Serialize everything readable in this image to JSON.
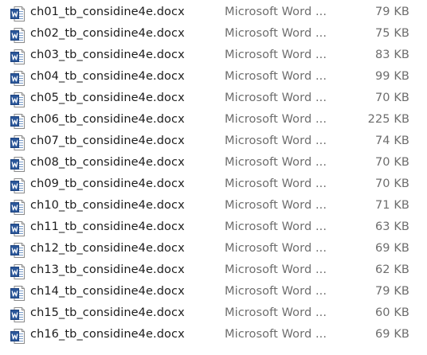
{
  "file_list": {
    "icon": "word-document-icon",
    "colors": {
      "word_blue": "#2b579a",
      "name_text": "#1c1c1c",
      "secondary_text": "#6d6d6d"
    },
    "rows": [
      {
        "name": "ch01_tb_considine4e.docx",
        "type": "Microsoft Word ...",
        "size": "79 KB"
      },
      {
        "name": "ch02_tb_considine4e.docx",
        "type": "Microsoft Word ...",
        "size": "75 KB"
      },
      {
        "name": "ch03_tb_considine4e.docx",
        "type": "Microsoft Word ...",
        "size": "83 KB"
      },
      {
        "name": "ch04_tb_considine4e.docx",
        "type": "Microsoft Word ...",
        "size": "99 KB"
      },
      {
        "name": "ch05_tb_considine4e.docx",
        "type": "Microsoft Word ...",
        "size": "70 KB"
      },
      {
        "name": "ch06_tb_considine4e.docx",
        "type": "Microsoft Word ...",
        "size": "225 KB"
      },
      {
        "name": "ch07_tb_considine4e.docx",
        "type": "Microsoft Word ...",
        "size": "74 KB"
      },
      {
        "name": "ch08_tb_considine4e.docx",
        "type": "Microsoft Word ...",
        "size": "70 KB"
      },
      {
        "name": "ch09_tb_considine4e.docx",
        "type": "Microsoft Word ...",
        "size": "70 KB"
      },
      {
        "name": "ch10_tb_considine4e.docx",
        "type": "Microsoft Word ...",
        "size": "71 KB"
      },
      {
        "name": "ch11_tb_considine4e.docx",
        "type": "Microsoft Word ...",
        "size": "63 KB"
      },
      {
        "name": "ch12_tb_considine4e.docx",
        "type": "Microsoft Word ...",
        "size": "69 KB"
      },
      {
        "name": "ch13_tb_considine4e.docx",
        "type": "Microsoft Word ...",
        "size": "62 KB"
      },
      {
        "name": "ch14_tb_considine4e.docx",
        "type": "Microsoft Word ...",
        "size": "79 KB"
      },
      {
        "name": "ch15_tb_considine4e.docx",
        "type": "Microsoft Word ...",
        "size": "60 KB"
      },
      {
        "name": "ch16_tb_considine4e.docx",
        "type": "Microsoft Word ...",
        "size": "69 KB"
      }
    ]
  }
}
